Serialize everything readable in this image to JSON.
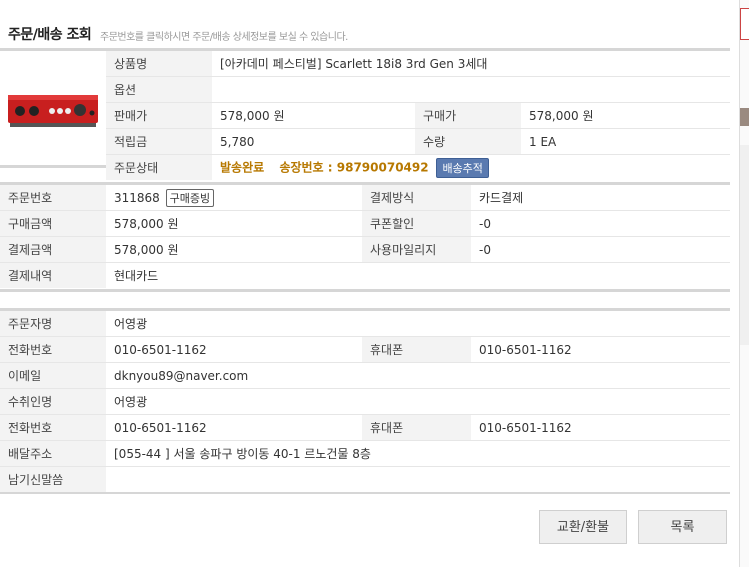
{
  "header": {
    "title": "주문/배송 조회",
    "description": "주문번호를 클릭하시면 주문/배송 상세정보를 보실 수 있습니다."
  },
  "product": {
    "name_label": "상품명",
    "name": "[아카데미 페스티벌] Scarlett 18i8 3rd Gen 3세대",
    "option_label": "옵션",
    "option": "",
    "sale_price_label": "판매가",
    "sale_price": "578,000 원",
    "purchase_price_label": "구매가",
    "purchase_price": "578,000 원",
    "points_label": "적립금",
    "points": "5,780",
    "qty_label": "수량",
    "qty": "1 EA",
    "status_label": "주문상태",
    "status": "발송완료",
    "tracking": "송장번호 : 98790070492",
    "track_button": "배송추적"
  },
  "payment": {
    "order_no_label": "주문번호",
    "order_no": "311868",
    "receipt_button": "구매증빙",
    "method_label": "결제방식",
    "method": "카드결제",
    "purchase_amount_label": "구매금액",
    "purchase_amount": "578,000 원",
    "coupon_label": "쿠폰할인",
    "coupon": "-0",
    "paid_amount_label": "결제금액",
    "paid_amount": "578,000 원",
    "mileage_label": "사용마일리지",
    "mileage": "-0",
    "detail_label": "결제내역",
    "detail": "현대카드"
  },
  "customer": {
    "orderer_label": "주문자명",
    "orderer": "어영광",
    "phone_label": "전화번호",
    "phone": "010-6501-1162",
    "mobile_label": "휴대폰",
    "mobile": "010-6501-1162",
    "email_label": "이메일",
    "email": "dknyou89@naver.com",
    "receiver_label": "수취인명",
    "receiver": "어영광",
    "receiver_phone_label": "전화번호",
    "receiver_phone": "010-6501-1162",
    "receiver_mobile_label": "휴대폰",
    "receiver_mobile": "010-6501-1162",
    "address_label": "배달주소",
    "address": "[055-44 ]   서울 송파구 방이동 40-1 르노건물 8층",
    "message_label": "남기신말씀",
    "message": ""
  },
  "buttons": {
    "exchange": "교환/환불",
    "list": "목록"
  },
  "colors": {
    "highlight": "#b77800",
    "track_button": "#5a7ab0",
    "label_bg": "#f3f3f3"
  }
}
